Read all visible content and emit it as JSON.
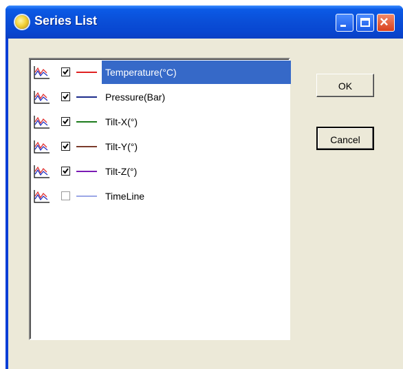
{
  "window": {
    "title": "Series List",
    "buttons": {
      "minimize": "minimize",
      "maximize": "maximize",
      "close": "close"
    }
  },
  "series": [
    {
      "label": "Temperature(°C)",
      "checked": true,
      "color": "#e02020",
      "selected": true
    },
    {
      "label": "Pressure(Bar)",
      "checked": true,
      "color": "#1a2a8a",
      "selected": false
    },
    {
      "label": "Tilt-X(°)",
      "checked": true,
      "color": "#1a7a1a",
      "selected": false
    },
    {
      "label": "Tilt-Y(°)",
      "checked": true,
      "color": "#7a3a2a",
      "selected": false
    },
    {
      "label": "Tilt-Z(°)",
      "checked": true,
      "color": "#7a1ab4",
      "selected": false
    },
    {
      "label": "TimeLine",
      "checked": false,
      "color": "#9aa6e6",
      "selected": false
    }
  ],
  "actions": {
    "ok_label": "OK",
    "cancel_label": "Cancel"
  },
  "icons": {
    "app": "app-icon",
    "series": "line-chart-icon"
  }
}
